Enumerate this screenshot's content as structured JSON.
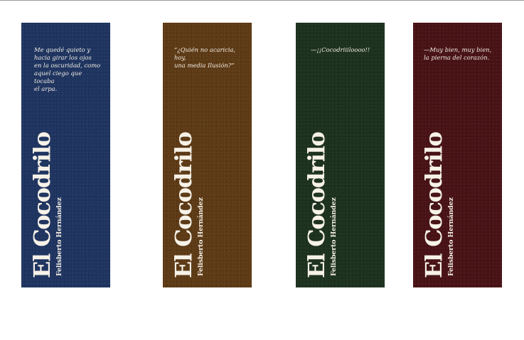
{
  "bookmarks": [
    {
      "color": "#1c325e",
      "quote": "Me quedé quieto y\nhacia girar los ojos\nen la oscuridad, como\naquel ciego que tocaba\nel arpa.",
      "title": "El Cocodrilo",
      "author": "Felisberto Hernández"
    },
    {
      "color": "#5b3813",
      "quote": "“¿Quién no acaricia, hoy,\nuna media Ilusión?”",
      "title": "El Cocodrilo",
      "author": "Felisberto Hernández"
    },
    {
      "color": "#1a2f1c",
      "quote": "—¡¡Cocodriiiloooo!!",
      "title": "El Cocodrilo",
      "author": "Felisberto Hernández"
    },
    {
      "color": "#461013",
      "quote": "—Muy bien, muy bien,\nla pierna del corazón.",
      "title": "El Cocodrilo",
      "author": "Felisberto Hernández"
    }
  ]
}
